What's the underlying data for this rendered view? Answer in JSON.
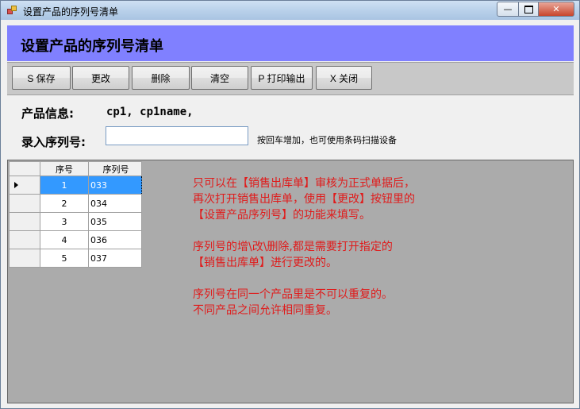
{
  "window": {
    "title": "设置产品的序列号清单"
  },
  "banner": {
    "title": "设置产品的序列号清单"
  },
  "toolbar": {
    "save": "S 保存",
    "edit": "更改",
    "delete": "删除",
    "clear": "清空",
    "print": "P 打印输出",
    "close": "X 关闭"
  },
  "product": {
    "label": "产品信息:",
    "value": "cp1, cp1name,"
  },
  "serial_input": {
    "label": "录入序列号:",
    "value": "",
    "hint": "按回车增加，也可使用条码扫描设备"
  },
  "grid": {
    "columns": [
      "序号",
      "序列号"
    ],
    "rows": [
      {
        "no": "1",
        "serial": "033"
      },
      {
        "no": "2",
        "serial": "034"
      },
      {
        "no": "3",
        "serial": "035"
      },
      {
        "no": "4",
        "serial": "036"
      },
      {
        "no": "5",
        "serial": "037"
      }
    ],
    "selected_row": 0
  },
  "notes": {
    "p1": [
      "只可以在【销售出库单】审核为正式单据后，",
      "再次打开销售出库单，使用【更改】按钮里的",
      "【设置产品序列号】的功能来填写。"
    ],
    "p2": [
      "序列号的增\\改\\删除,都是需要打开指定的",
      "【销售出库单】进行更改的。"
    ],
    "p3": [
      "序列号在同一个产品里是不可以重复的。",
      "不同产品之间允许相同重复。"
    ]
  }
}
